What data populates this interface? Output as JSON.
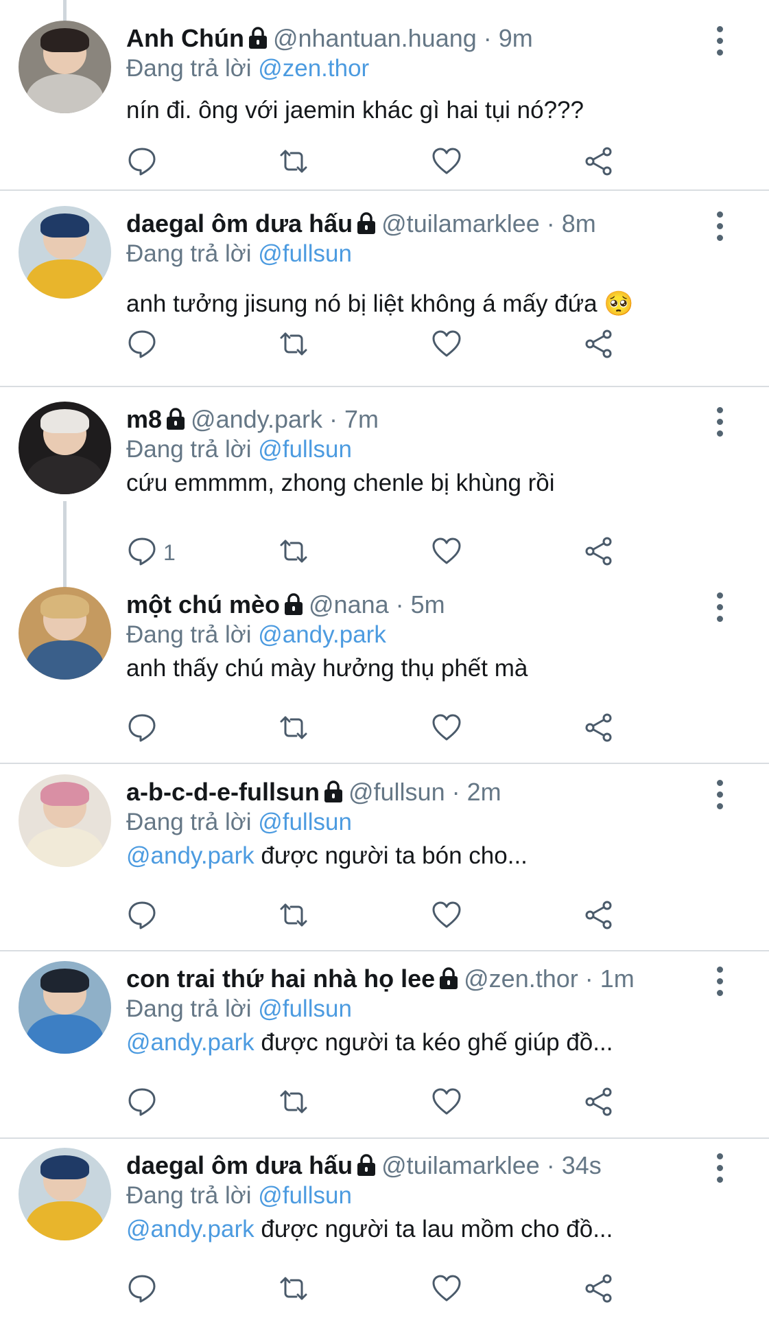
{
  "replying_prefix": "Đang trả lời",
  "tweets": [
    {
      "name": "Anh Chún",
      "handle": "@nhantuan.huang",
      "time": "9m",
      "reply_to": "@zen.thor",
      "text_mention": "",
      "text": "nín đi. ông với jaemin khác gì hai tụi nó???",
      "reply_count": "",
      "avatar_colors": {
        "bg": "#8a857d",
        "hair": "#2a2220",
        "body": "#c9c6c1"
      }
    },
    {
      "name": "daegal ôm dưa hấu",
      "handle": "@tuilamarklee",
      "time": "8m",
      "reply_to": "@fullsun",
      "text_mention": "",
      "text": "anh tưởng jisung nó bị liệt không á mấy đứa 🥺",
      "reply_count": "",
      "avatar_colors": {
        "bg": "#c8d6de",
        "hair": "#1f3a66",
        "body": "#e8b52c"
      }
    },
    {
      "name": "m8",
      "handle": "@andy.park",
      "time": "7m",
      "reply_to": "@fullsun",
      "text_mention": "",
      "text": "cứu emmmm, zhong chenle bị khùng rồi",
      "reply_count": "1",
      "avatar_colors": {
        "bg": "#1e1c1d",
        "hair": "#e9e6e2",
        "body": "#2b2829"
      }
    },
    {
      "name": "một chú mèo",
      "handle": "@nana",
      "time": "5m",
      "reply_to": "@andy.park",
      "text_mention": "",
      "text": "anh thấy chú mày hưởng thụ phết mà",
      "reply_count": "",
      "avatar_colors": {
        "bg": "#c59a60",
        "hair": "#d8b67a",
        "body": "#3a5f8a"
      }
    },
    {
      "name": "a-b-c-d-e-fullsun",
      "handle": "@fullsun",
      "time": "2m",
      "reply_to": "@fullsun",
      "text_mention": "@andy.park",
      "text": "được người ta bón cho...",
      "reply_count": "",
      "avatar_colors": {
        "bg": "#e8e2da",
        "hair": "#d98fa4",
        "body": "#f1ead8"
      }
    },
    {
      "name": "con trai thứ hai nhà họ lee",
      "handle": "@zen.thor",
      "time": "1m",
      "reply_to": "@fullsun",
      "text_mention": "@andy.park",
      "text": "được người ta kéo ghế giúp đồ...",
      "reply_count": "",
      "avatar_colors": {
        "bg": "#8fb0c8",
        "hair": "#1e2530",
        "body": "#3d7fc4"
      }
    },
    {
      "name": "daegal ôm dưa hấu",
      "handle": "@tuilamarklee",
      "time": "34s",
      "reply_to": "@fullsun",
      "text_mention": "@andy.park",
      "text": "được người ta lau mồm cho đồ...",
      "reply_count": "",
      "avatar_colors": {
        "bg": "#c8d6de",
        "hair": "#1f3a66",
        "body": "#e8b52c"
      }
    }
  ]
}
